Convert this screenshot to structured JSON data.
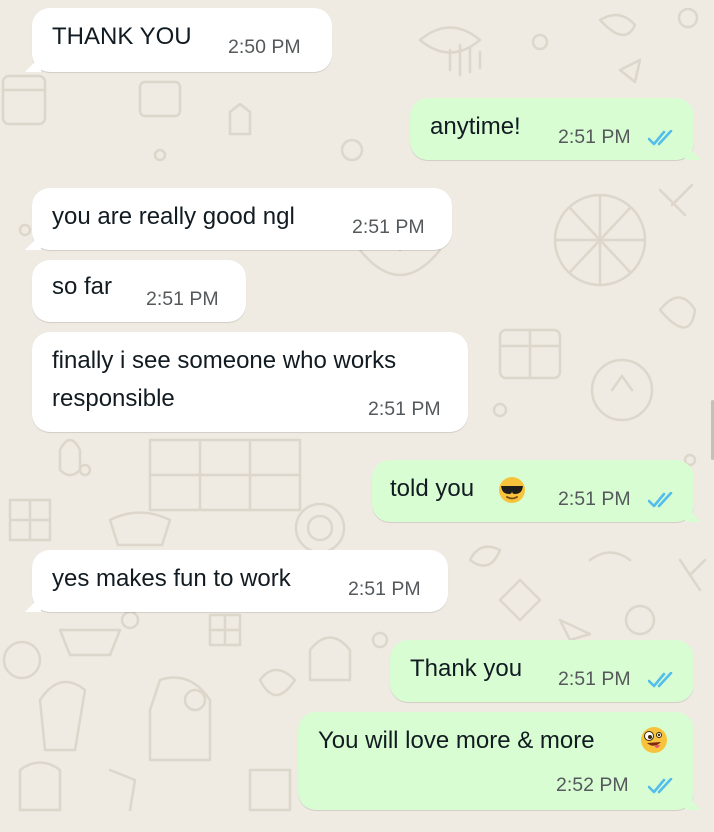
{
  "chat": {
    "messages": [
      {
        "direction": "in",
        "text": "THANK YOU",
        "time": "2:50 PM"
      },
      {
        "direction": "out",
        "text": "anytime!",
        "time": "2:51 PM",
        "status": "read",
        "status_icon": "double-check-icon",
        "status_color": "#53bdeb"
      },
      {
        "direction": "in",
        "text": "you are really good ngl",
        "time": "2:51 PM"
      },
      {
        "direction": "in",
        "text": "so far",
        "time": "2:51 PM"
      },
      {
        "direction": "in",
        "text_line1": "finally i see someone who works",
        "text_line2": "responsible",
        "time": "2:51 PM"
      },
      {
        "direction": "out",
        "text": "told you",
        "emoji": "smiling-face-with-sunglasses",
        "time": "2:51 PM",
        "status": "read",
        "status_icon": "double-check-icon",
        "status_color": "#53bdeb"
      },
      {
        "direction": "in",
        "text": "yes makes fun to work",
        "time": "2:51 PM"
      },
      {
        "direction": "out",
        "text": "Thank you",
        "time": "2:51 PM",
        "status": "read",
        "status_icon": "double-check-icon",
        "status_color": "#53bdeb"
      },
      {
        "direction": "out",
        "text": "You will love more & more",
        "emoji": "zany-face",
        "time": "2:52 PM",
        "status": "read",
        "status_icon": "double-check-icon",
        "status_color": "#53bdeb"
      }
    ]
  },
  "colors": {
    "chat_background": "#efeae2",
    "incoming_bubble": "#ffffff",
    "outgoing_bubble": "#d9fdd3",
    "read_ticks": "#53bdeb",
    "timestamp": "#667781"
  }
}
